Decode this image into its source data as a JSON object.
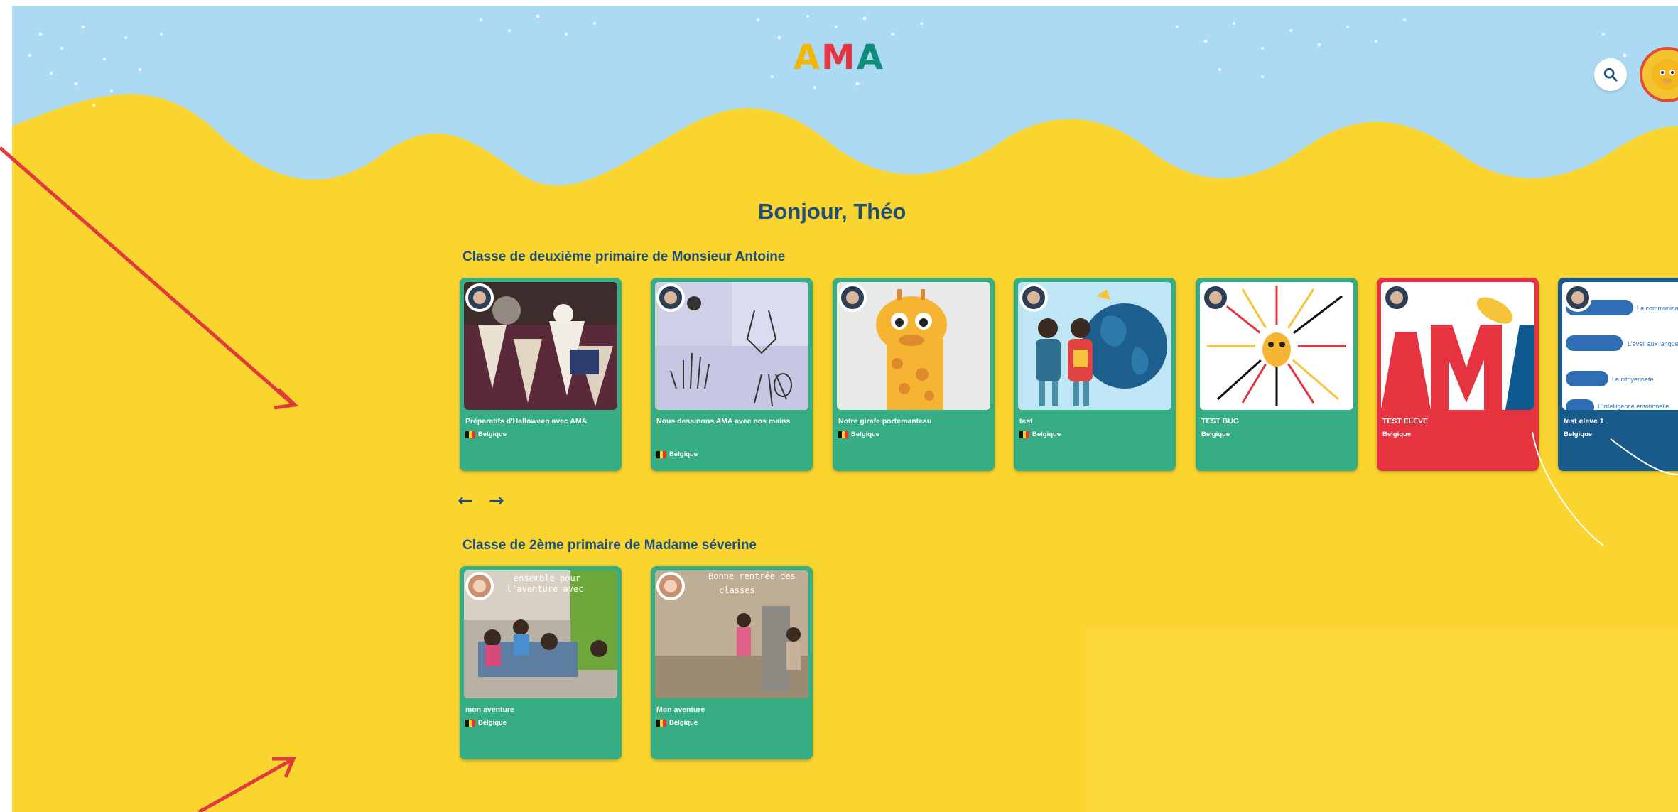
{
  "header": {
    "logo_letters": [
      "A",
      "M",
      "A"
    ],
    "logo_colors": [
      "#f2b705",
      "#e63340",
      "#0f8d7a"
    ],
    "search_icon": "search-icon",
    "avatar_icon": "giraffe-avatar-icon"
  },
  "greeting": "Bonjour, Théo",
  "classes": [
    {
      "title": "Classe de deuxième primaire de Monsieur Antoine",
      "cards": [
        {
          "title": "Préparatifs d'Halloween avec AMA",
          "country": "Belgique",
          "flag": true,
          "color": "#37ad83"
        },
        {
          "title": "Nous dessinons AMA avec nos mains",
          "country": "Belgique",
          "flag": true,
          "color": "#37ad83"
        },
        {
          "title": "Notre girafe portemanteau",
          "country": "Belgique",
          "flag": true,
          "color": "#37ad83"
        },
        {
          "title": "test",
          "country": "Belgique",
          "flag": true,
          "color": "#37ad83"
        },
        {
          "title": "TEST BUG",
          "country": "Belgique",
          "flag": false,
          "color": "#37ad83"
        },
        {
          "title": "TEST ELEVE",
          "country": "Belgique",
          "flag": false,
          "color": "#e63340"
        },
        {
          "title": "test eleve 1",
          "country": "Belgique",
          "flag": false,
          "color": "#185a89"
        }
      ],
      "nav": {
        "prev": "←",
        "next": "→"
      }
    },
    {
      "title": "Classe de 2ème primaire de Madame séverine",
      "cards": [
        {
          "title": "mon aventure",
          "country": "Belgique",
          "flag": true,
          "color": "#37ad83"
        },
        {
          "title": "Mon aventure",
          "country": "Belgique",
          "flag": true,
          "color": "#37ad83"
        }
      ]
    }
  ],
  "thumb_texts": {
    "card7_lines": [
      "La communicatio",
      "L'éveil aux langues",
      "La citoyenneté",
      "L'intelligence émotionelle"
    ],
    "card9_line1": "Bonne rentrée des",
    "card9_line2": "classes",
    "card8_line1": "ensemble pour",
    "card8_line2": "l'aventure avec"
  }
}
